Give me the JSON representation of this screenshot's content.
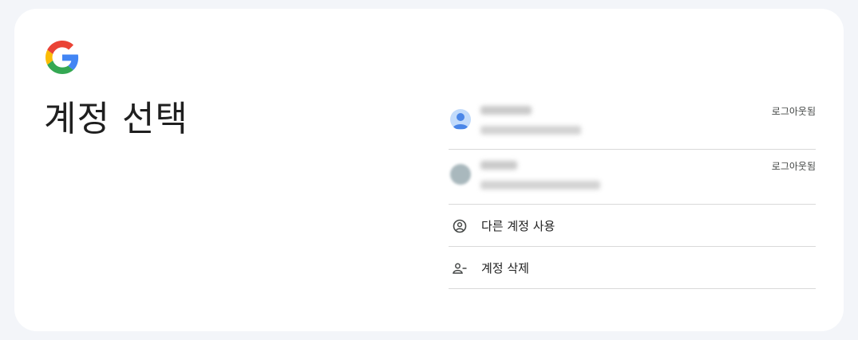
{
  "page": {
    "title": "계정 선택"
  },
  "logo": {
    "icon": "google-g-logo"
  },
  "accounts": [
    {
      "signed_out_label": "로그아웃됨",
      "avatar_color": "#c2dbfb",
      "avatar_icon": "person-icon"
    },
    {
      "signed_out_label": "로그아웃됨",
      "avatar_color": "#a9b8bd",
      "avatar_icon": "photo-avatar"
    }
  ],
  "actions": [
    {
      "label": "다른 계정 사용",
      "icon": "account-circle-icon"
    },
    {
      "label": "계정 삭제",
      "icon": "person-remove-icon"
    }
  ],
  "colors": {
    "background": "#f3f5f9",
    "card": "#ffffff",
    "divider": "#d9d9d9",
    "text": "#1f1f1f"
  }
}
